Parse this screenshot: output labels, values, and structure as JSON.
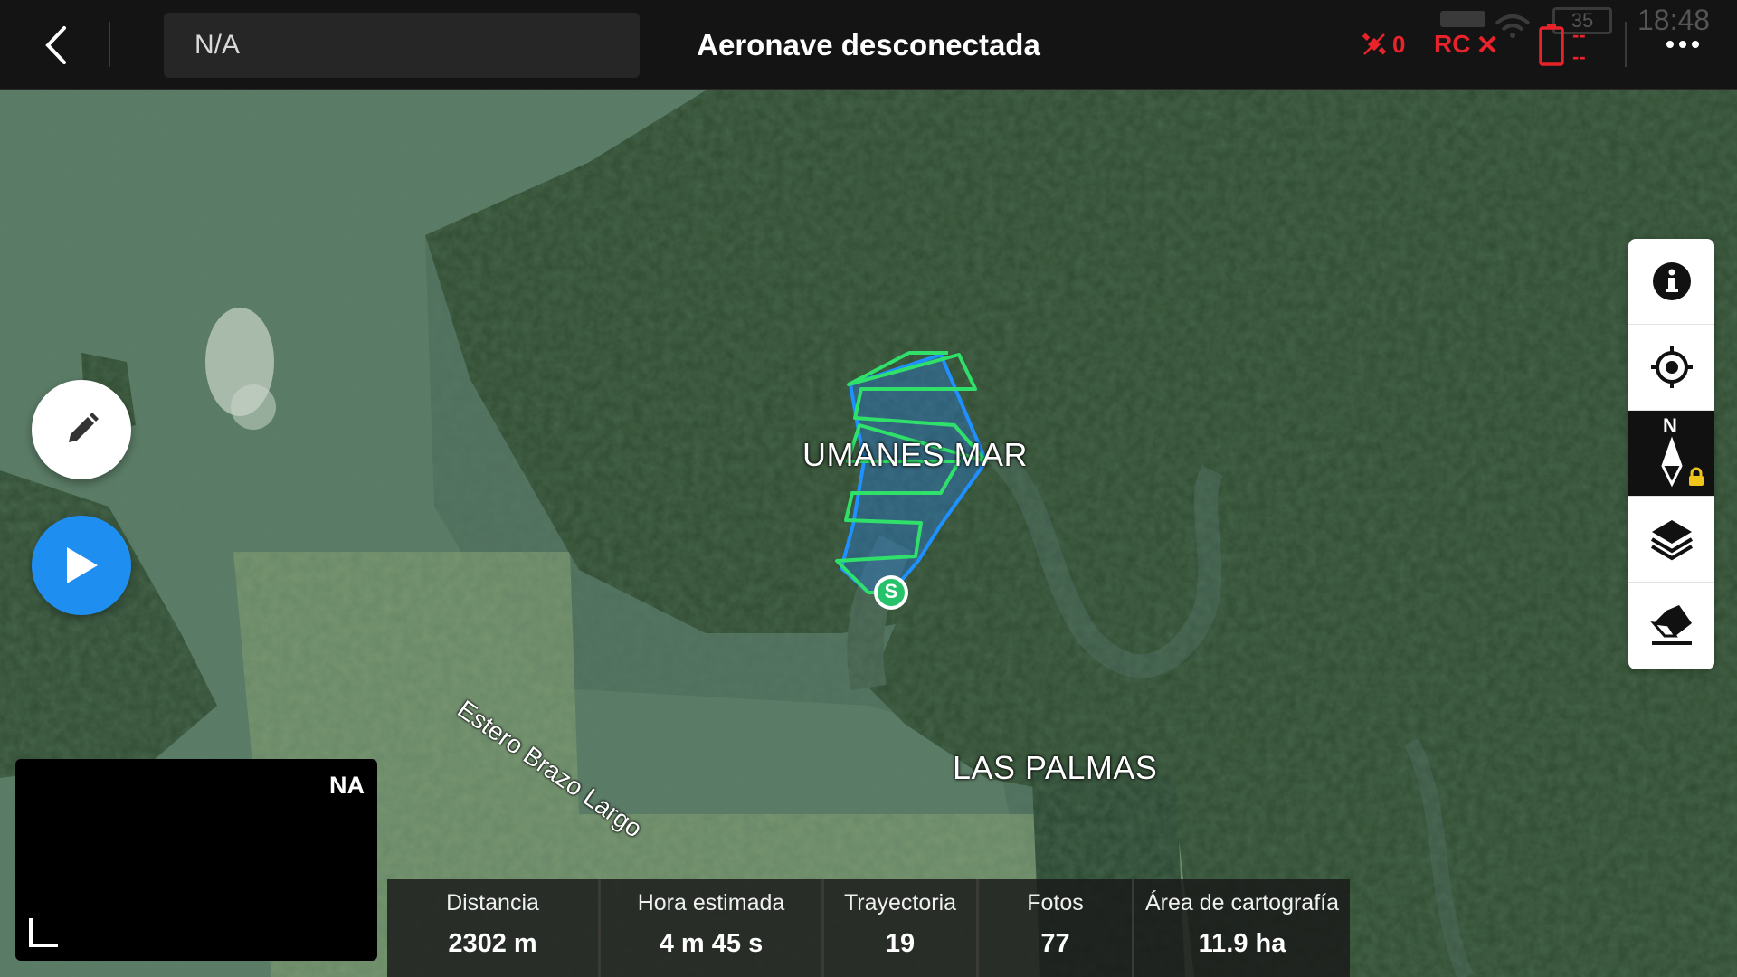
{
  "topbar": {
    "field_value": "N/A",
    "title": "Aeronave desconectada",
    "satellite_count": "0",
    "rc_label": "RC",
    "rc_status_icon": "x-icon",
    "battery_top": "--",
    "battery_bottom": "--",
    "remote_battery": "35",
    "time": "18:48"
  },
  "map": {
    "labels": {
      "area1": "UMANES MAR",
      "area2": "LAS PALMAS",
      "river": "Estero Brazo Largo"
    },
    "start_marker": "S",
    "flight_path_color": "#2fe06a",
    "area_color": "#1e90ff"
  },
  "camera": {
    "status": "NA"
  },
  "right_tools": [
    "info-icon",
    "locate-icon",
    "compass-north-icon",
    "layers-icon",
    "eraser-icon"
  ],
  "compass_label": "N",
  "stats": [
    {
      "label": "Distancia",
      "value": "2302 m"
    },
    {
      "label": "Hora estimada",
      "value": "4 m 45 s"
    },
    {
      "label": "Trayectoria",
      "value": "19"
    },
    {
      "label": "Fotos",
      "value": "77"
    },
    {
      "label": "Área de cartografía",
      "value": "11.9 ha"
    }
  ],
  "colors": {
    "accent_blue": "#1f8ef1",
    "alert_red": "#e8232b"
  }
}
